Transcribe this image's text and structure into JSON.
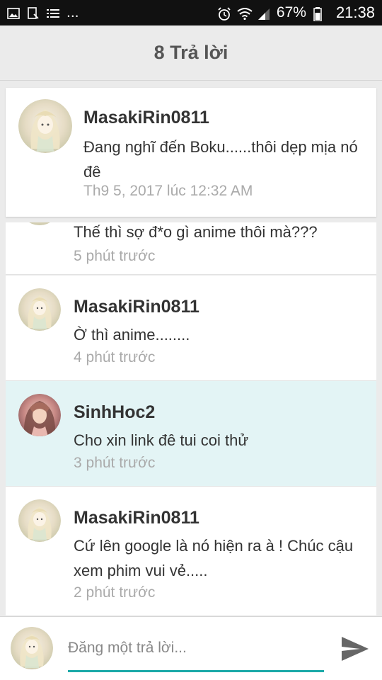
{
  "status_bar": {
    "more": "...",
    "battery": "67%",
    "time": "21:38"
  },
  "header": {
    "title": "8 Trả lời"
  },
  "original_post": {
    "user": "MasakiRin0811",
    "text": "Đang nghĩ đến Boku......thôi dẹp mịa nó đê",
    "time": "Th9 5, 2017 lúc 12:32 AM",
    "avatar_icon": "anime-girl-avatar"
  },
  "replies": [
    {
      "user": "",
      "text": "Thế thì sợ đ*o gì anime thôi mà???",
      "time": "5 phút trước",
      "avatar_icon": "anime-girl-avatar"
    },
    {
      "user": "MasakiRin0811",
      "text": "Ờ thì anime........",
      "time": "4 phút trước",
      "avatar_icon": "anime-girl-avatar"
    },
    {
      "user": "SinhHoc2",
      "text": "Cho xin link đê tui coi thử",
      "time": "3 phút trước",
      "avatar_icon": "girl-photo-avatar"
    },
    {
      "user": "MasakiRin0811",
      "text": "Cứ lên google là nó hiện ra à ! Chúc cậu xem phim vui vẻ.....",
      "time": "2 phút trước",
      "avatar_icon": "anime-girl-avatar"
    }
  ],
  "compose": {
    "placeholder": "Đăng một trả lời...",
    "send_icon": "send-icon",
    "accent": "#1ba9a8"
  },
  "colors": {
    "highlight_row": "#e3f4f5",
    "background": "#ebebeb"
  }
}
